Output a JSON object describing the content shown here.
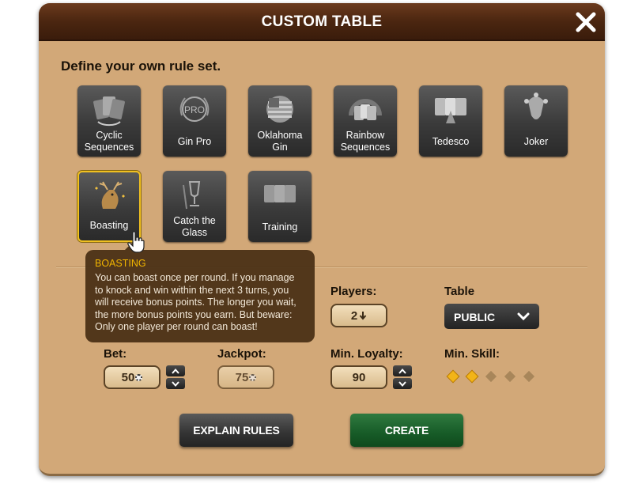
{
  "dialog": {
    "title": "CUSTOM TABLE",
    "subtitle": "Define your own rule set."
  },
  "rule_sets": [
    {
      "label": "Cyclic\nSequences",
      "icon": "cyclic-cards-icon"
    },
    {
      "label": "Gin Pro",
      "icon": "laurel-pro-icon"
    },
    {
      "label": "Oklahoma\nGin",
      "icon": "us-flag-icon"
    },
    {
      "label": "Rainbow\nSequences",
      "icon": "rainbow-cards-icon"
    },
    {
      "label": "Tedesco",
      "icon": "aces-icon"
    },
    {
      "label": "Joker",
      "icon": "jester-icon"
    },
    {
      "label": "Boasting",
      "icon": "boasting-deer-icon",
      "selected": true
    },
    {
      "label": "Catch the\nGlass",
      "icon": "glass-icon"
    },
    {
      "label": "Training",
      "icon": "training-cards-icon"
    }
  ],
  "tooltip": {
    "title": "BOASTING",
    "body": "You can boast once per round. If you manage to knock and win within the next 3 turns, you will receive bonus points. The longer you wait, the more bonus points you earn. But beware: Only one player per round can boast!"
  },
  "settings": {
    "players_label": "Players:",
    "players_value": "2",
    "table_label": "Table",
    "table_value": "PUBLIC",
    "bet_label": "Bet:",
    "bet_value": "50",
    "jackpot_label": "Jackpot:",
    "jackpot_value": "75",
    "loyalty_label": "Min. Loyalty:",
    "loyalty_value": "90",
    "skill_label": "Min. Skill:",
    "skill_level": 2,
    "skill_max": 5
  },
  "buttons": {
    "explain": "EXPLAIN RULES",
    "create": "CREATE"
  },
  "colors": {
    "panel": "#d2a878",
    "header": "#4b2610",
    "accent_gold": "#f0b400",
    "create_green": "#175b27"
  }
}
